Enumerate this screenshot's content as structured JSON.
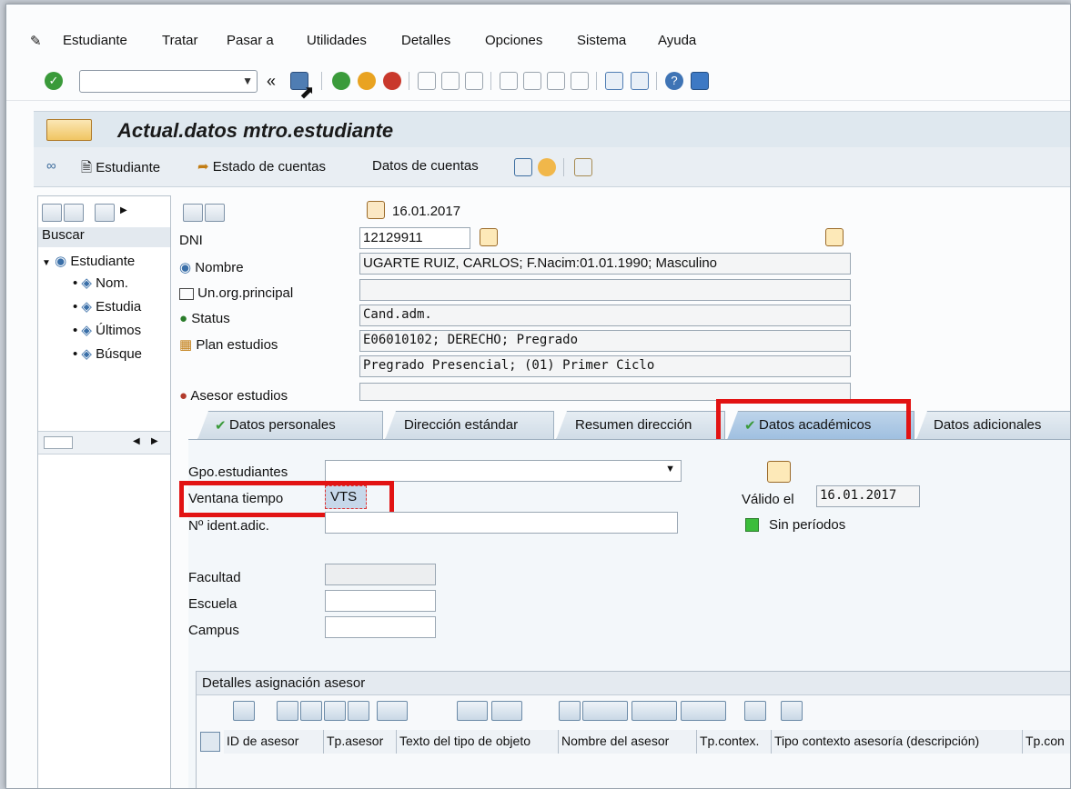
{
  "menubar": {
    "items": [
      {
        "label": "Estudiante",
        "u": "E"
      },
      {
        "label": "Tratar",
        "u": "T"
      },
      {
        "label": "Pasar a",
        "u": "P"
      },
      {
        "label": "Utilidades",
        "u": "U"
      },
      {
        "label": "Detalles",
        "u": "D"
      },
      {
        "label": "Opciones",
        "u": "O"
      },
      {
        "label": "Sistema",
        "u": "S"
      },
      {
        "label": "Ayuda",
        "u": "y"
      }
    ]
  },
  "toolbar": {
    "command_value": "",
    "back_label": "«"
  },
  "title": "Actual.datos mtro.estudiante",
  "appbar": {
    "estudiante": "Estudiante",
    "estado_cuentas": "Estado de cuentas",
    "datos_cuentas": "Datos de cuentas"
  },
  "leftnav": {
    "header": "Buscar",
    "root": "Estudiante",
    "items": [
      "Nom.",
      "Estudia",
      "Últimos",
      "Búsque"
    ]
  },
  "header_date": "16.01.2017",
  "form": {
    "dni_label": "DNI",
    "dni_value": "12129911",
    "nombre_label": "Nombre",
    "nombre_value": "UGARTE RUIZ, CARLOS; F.Nacim:01.01.1990; Masculino",
    "unorg_label": "Un.org.principal",
    "unorg_value": "",
    "status_label": "Status",
    "status_value": "Cand.adm.",
    "plan_label": "Plan estudios",
    "plan_value": "E06010102; DERECHO; Pregrado",
    "plan_value2": "Pregrado Presencial; (01) Primer Ciclo",
    "asesor_label": "Asesor estudios",
    "asesor_value": ""
  },
  "tabs": [
    {
      "label": "Datos personales",
      "check": true,
      "active": false
    },
    {
      "label": "Dirección estándar",
      "check": false,
      "active": false
    },
    {
      "label": "Resumen dirección",
      "check": false,
      "active": false
    },
    {
      "label": "Datos académicos",
      "check": true,
      "active": true
    },
    {
      "label": "Datos adicionales",
      "check": false,
      "active": false
    }
  ],
  "academic": {
    "gpo_label": "Gpo.estudiantes",
    "gpo_value": "",
    "ventana_label": "Ventana tiempo",
    "ventana_value": "VTS",
    "nident_label": "Nº ident.adic.",
    "nident_value": "",
    "valido_label": "Válido el",
    "valido_value": "16.01.2017",
    "periodos_label": "Sin períodos",
    "facultad_label": "Facultad",
    "escuela_label": "Escuela",
    "campus_label": "Campus"
  },
  "grid": {
    "title": "Detalles asignación asesor",
    "columns": [
      "ID de asesor",
      "Tp.asesor",
      "Texto del tipo de objeto",
      "Nombre del asesor",
      "Tp.contex.",
      "Tipo contexto asesoría (descripción)",
      "Tp.con"
    ]
  },
  "colors": {
    "accent": "#2f6fb0",
    "highlight": "#e21313",
    "ok_green": "#3a9a3a"
  }
}
